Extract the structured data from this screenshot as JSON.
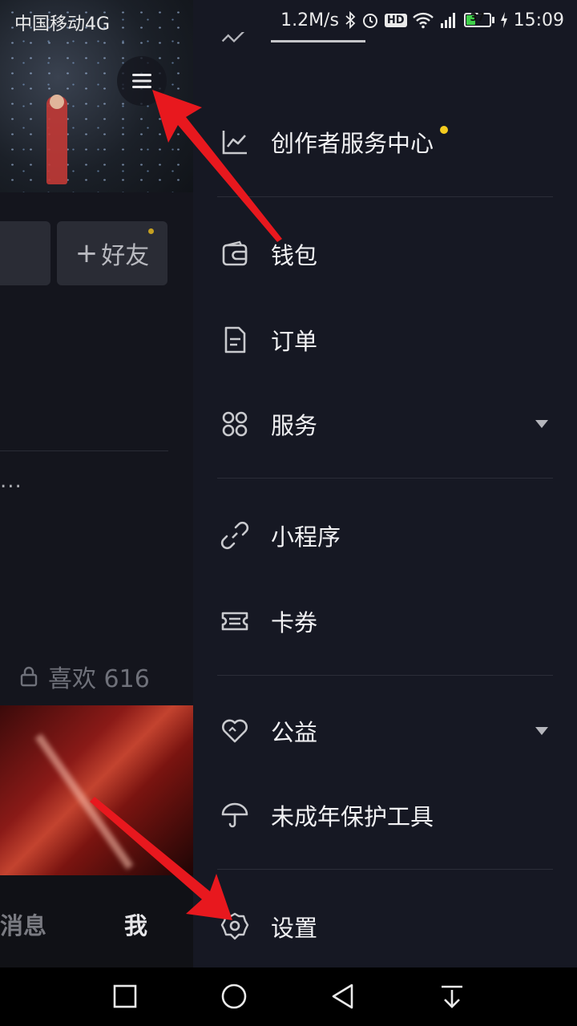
{
  "status_bar": {
    "carrier": "中国移动4G",
    "speed": "1.2M/s",
    "hd": "HD",
    "battery_level": "37",
    "time": "15:09"
  },
  "profile": {
    "add_friend_label": "好友",
    "more_dots": "...",
    "likes_label": "喜欢 616",
    "tab_messages": "消息",
    "tab_me": "我"
  },
  "drawer": {
    "items": [
      {
        "label": "创作者服务中心",
        "icon": "chart-icon",
        "has_dot": true
      },
      {
        "label": "钱包",
        "icon": "wallet-icon"
      },
      {
        "label": "订单",
        "icon": "order-doc-icon"
      },
      {
        "label": "服务",
        "icon": "grid-icon",
        "expandable": true
      },
      {
        "label": "小程序",
        "icon": "link-icon"
      },
      {
        "label": "卡券",
        "icon": "ticket-icon"
      },
      {
        "label": "公益",
        "icon": "heart-icon",
        "expandable": true
      },
      {
        "label": "未成年保护工具",
        "icon": "umbrella-icon"
      },
      {
        "label": "设置",
        "icon": "settings-gear-icon"
      }
    ]
  },
  "colors": {
    "drawer_bg": "#161823",
    "notify_dot": "#f5cc1f",
    "annotation_arrow": "#e8181e"
  }
}
